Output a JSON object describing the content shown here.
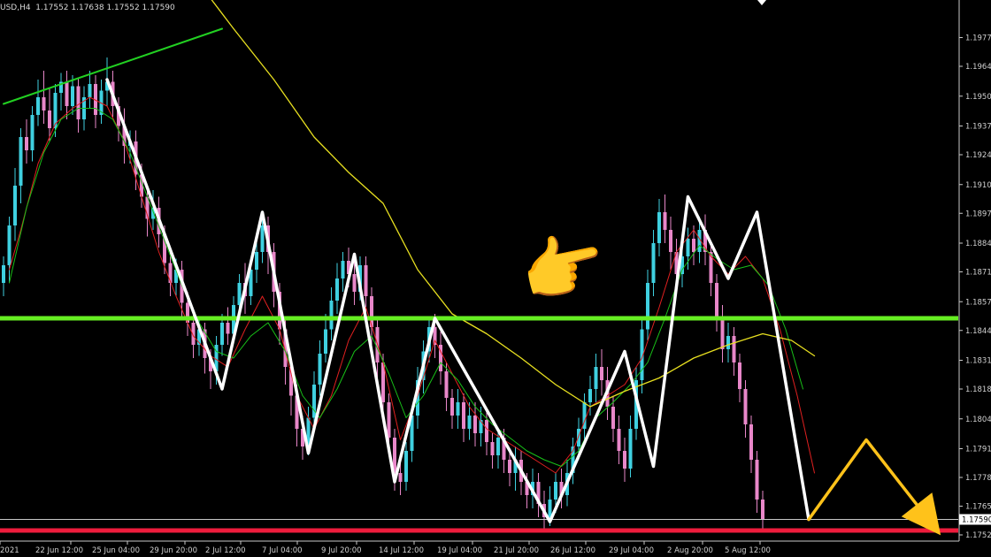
{
  "header": {
    "symbol_info": "USD,H4  1.17552 1.17638 1.17552 1.17590"
  },
  "colors": {
    "background": "#000000",
    "candle_bull": "#3fd0e0",
    "candle_bear": "#e887c9",
    "ma_fast": "#e02020",
    "ma_mid": "#18c018",
    "ma_slow": "#e8e020",
    "trendline": "#22d022",
    "support_line": "#66ee22",
    "low_line": "#ee1c3c",
    "zigzag": "#ffffff",
    "projection": "#ffc21a",
    "price_line": "#c8c8c8"
  },
  "annotation": {
    "pointer_icon": "pointing-hand-icon"
  },
  "chart_data": {
    "type": "candlestick",
    "title": "",
    "ylim": [
      1.175,
      1.199
    ],
    "y_ticks": [
      "1.19770",
      "1.19640",
      "1.19505",
      "1.19370",
      "1.19240",
      "1.19105",
      "1.18975",
      "1.18840",
      "1.18710",
      "1.18575",
      "1.18445",
      "1.18310",
      "1.18180",
      "1.18045",
      "1.17910",
      "1.17780",
      "1.17650",
      "1.17520"
    ],
    "x_ticks": [
      "2021",
      "22 Jun 12:00",
      "25 Jun 04:00",
      "29 Jun 20:00",
      "2 Jul 12:00",
      "7 Jul 04:00",
      "9 Jul 20:00",
      "14 Jul 12:00",
      "19 Jul 04:00",
      "21 Jul 20:00",
      "26 Jul 12:00",
      "29 Jul 04:00",
      "2 Aug 20:00",
      "5 Aug 12:00"
    ],
    "current_price": "1.17590",
    "support_level": 1.185,
    "low_level": 1.1754,
    "trendline": {
      "points": [
        [
          0,
          1.1947
        ],
        [
          38,
          1.1981
        ]
      ]
    },
    "zigzag": [
      [
        18,
        1.1958
      ],
      [
        38,
        1.1818
      ],
      [
        45,
        1.1898
      ],
      [
        53,
        1.1789
      ],
      [
        61,
        1.1879
      ],
      [
        68,
        1.1776
      ],
      [
        75,
        1.185
      ],
      [
        95,
        1.1758
      ],
      [
        108,
        1.1835
      ],
      [
        113,
        1.1783
      ],
      [
        119,
        1.1905
      ],
      [
        126,
        1.1868
      ],
      [
        131,
        1.1898
      ],
      [
        140,
        1.1759
      ]
    ],
    "projection": [
      [
        140,
        1.1759
      ],
      [
        150,
        1.1795
      ],
      [
        162,
        1.1755
      ]
    ],
    "ma_slow": [
      [
        33,
        1.2005
      ],
      [
        40,
        1.1981
      ],
      [
        47,
        1.1958
      ],
      [
        54,
        1.1932
      ],
      [
        60,
        1.1916
      ],
      [
        66,
        1.1902
      ],
      [
        72,
        1.1872
      ],
      [
        78,
        1.1852
      ],
      [
        84,
        1.1843
      ],
      [
        90,
        1.1832
      ],
      [
        96,
        1.182
      ],
      [
        102,
        1.181
      ],
      [
        108,
        1.1817
      ],
      [
        114,
        1.1823
      ],
      [
        120,
        1.1832
      ],
      [
        126,
        1.1838
      ],
      [
        132,
        1.1843
      ],
      [
        137,
        1.184
      ],
      [
        141,
        1.1833
      ]
    ],
    "ma_fast": [
      [
        1,
        1.1872
      ],
      [
        3,
        1.189
      ],
      [
        6,
        1.192
      ],
      [
        9,
        1.1938
      ],
      [
        12,
        1.1945
      ],
      [
        15,
        1.195
      ],
      [
        18,
        1.1946
      ],
      [
        21,
        1.193
      ],
      [
        24,
        1.1905
      ],
      [
        27,
        1.188
      ],
      [
        30,
        1.186
      ],
      [
        33,
        1.1842
      ],
      [
        36,
        1.1833
      ],
      [
        39,
        1.1828
      ],
      [
        42,
        1.1845
      ],
      [
        45,
        1.186
      ],
      [
        48,
        1.1845
      ],
      [
        51,
        1.1815
      ],
      [
        54,
        1.18
      ],
      [
        57,
        1.1815
      ],
      [
        60,
        1.184
      ],
      [
        63,
        1.1855
      ],
      [
        66,
        1.183
      ],
      [
        69,
        1.1795
      ],
      [
        72,
        1.1815
      ],
      [
        75,
        1.184
      ],
      [
        78,
        1.1825
      ],
      [
        81,
        1.181
      ],
      [
        84,
        1.18
      ],
      [
        87,
        1.1795
      ],
      [
        90,
        1.179
      ],
      [
        93,
        1.1785
      ],
      [
        96,
        1.178
      ],
      [
        99,
        1.179
      ],
      [
        102,
        1.181
      ],
      [
        105,
        1.1815
      ],
      [
        108,
        1.182
      ],
      [
        111,
        1.1832
      ],
      [
        114,
        1.1855
      ],
      [
        117,
        1.188
      ],
      [
        120,
        1.189
      ],
      [
        123,
        1.1878
      ],
      [
        126,
        1.187
      ],
      [
        129,
        1.1878
      ],
      [
        132,
        1.1868
      ],
      [
        135,
        1.1845
      ],
      [
        138,
        1.1815
      ],
      [
        141,
        1.178
      ]
    ],
    "ma_mid": [
      [
        1,
        1.1866
      ],
      [
        4,
        1.19
      ],
      [
        7,
        1.1925
      ],
      [
        10,
        1.194
      ],
      [
        13,
        1.1945
      ],
      [
        16,
        1.1945
      ],
      [
        19,
        1.194
      ],
      [
        22,
        1.1925
      ],
      [
        25,
        1.1905
      ],
      [
        28,
        1.1885
      ],
      [
        31,
        1.1865
      ],
      [
        34,
        1.1848
      ],
      [
        37,
        1.1835
      ],
      [
        40,
        1.1832
      ],
      [
        43,
        1.1842
      ],
      [
        46,
        1.1848
      ],
      [
        49,
        1.1835
      ],
      [
        52,
        1.1815
      ],
      [
        55,
        1.1805
      ],
      [
        58,
        1.1818
      ],
      [
        61,
        1.1835
      ],
      [
        64,
        1.1842
      ],
      [
        67,
        1.1825
      ],
      [
        70,
        1.1805
      ],
      [
        73,
        1.1815
      ],
      [
        76,
        1.183
      ],
      [
        79,
        1.1822
      ],
      [
        82,
        1.181
      ],
      [
        85,
        1.1802
      ],
      [
        88,
        1.1796
      ],
      [
        91,
        1.179
      ],
      [
        94,
        1.1786
      ],
      [
        97,
        1.1783
      ],
      [
        100,
        1.179
      ],
      [
        103,
        1.1805
      ],
      [
        106,
        1.1812
      ],
      [
        109,
        1.182
      ],
      [
        112,
        1.183
      ],
      [
        115,
        1.185
      ],
      [
        118,
        1.1872
      ],
      [
        121,
        1.1883
      ],
      [
        124,
        1.1877
      ],
      [
        127,
        1.1872
      ],
      [
        130,
        1.1874
      ],
      [
        133,
        1.1865
      ],
      [
        136,
        1.1845
      ],
      [
        139,
        1.1818
      ]
    ],
    "candles": [
      [
        1.1866,
        1.1874,
        1.186,
        1.1878
      ],
      [
        1.1874,
        1.1892,
        1.1866,
        1.1896
      ],
      [
        1.1892,
        1.191,
        1.1885,
        1.1918
      ],
      [
        1.191,
        1.1932,
        1.1902,
        1.1936
      ],
      [
        1.1932,
        1.1926,
        1.192,
        1.194
      ],
      [
        1.1926,
        1.1942,
        1.1921,
        1.1946
      ],
      [
        1.1942,
        1.195,
        1.1937,
        1.1958
      ],
      [
        1.195,
        1.1944,
        1.1938,
        1.1962
      ],
      [
        1.1944,
        1.1936,
        1.193,
        1.1954
      ],
      [
        1.1936,
        1.1952,
        1.1932,
        1.1956
      ],
      [
        1.1952,
        1.1957,
        1.1944,
        1.1961
      ],
      [
        1.1957,
        1.1946,
        1.194,
        1.1962
      ],
      [
        1.1946,
        1.1955,
        1.1942,
        1.196
      ],
      [
        1.1955,
        1.194,
        1.1934,
        1.1959
      ],
      [
        1.194,
        1.195,
        1.1935,
        1.1955
      ],
      [
        1.195,
        1.1956,
        1.1945,
        1.1962
      ],
      [
        1.1956,
        1.1942,
        1.1936,
        1.196
      ],
      [
        1.1942,
        1.1953,
        1.1938,
        1.1958
      ],
      [
        1.1953,
        1.1957,
        1.1946,
        1.1968
      ],
      [
        1.1957,
        1.1946,
        1.1941,
        1.1962
      ],
      [
        1.1946,
        1.1937,
        1.193,
        1.195
      ],
      [
        1.1937,
        1.1928,
        1.192,
        1.1945
      ],
      [
        1.1928,
        1.193,
        1.192,
        1.1935
      ],
      [
        1.193,
        1.1915,
        1.1908,
        1.1935
      ],
      [
        1.1915,
        1.1905,
        1.19,
        1.192
      ],
      [
        1.1905,
        1.1895,
        1.1887,
        1.191
      ],
      [
        1.1895,
        1.19,
        1.189,
        1.1908
      ],
      [
        1.19,
        1.1888,
        1.1882,
        1.1905
      ],
      [
        1.1888,
        1.1875,
        1.187,
        1.1892
      ],
      [
        1.1875,
        1.1866,
        1.186,
        1.188
      ],
      [
        1.1866,
        1.1872,
        1.186,
        1.1877
      ],
      [
        1.1872,
        1.1857,
        1.185,
        1.1876
      ],
      [
        1.1857,
        1.1848,
        1.1842,
        1.1862
      ],
      [
        1.1848,
        1.1838,
        1.1832,
        1.1852
      ],
      [
        1.1838,
        1.1845,
        1.1833,
        1.185
      ],
      [
        1.1845,
        1.1832,
        1.1825,
        1.1848
      ],
      [
        1.1832,
        1.1826,
        1.1818,
        1.1836
      ],
      [
        1.1826,
        1.1838,
        1.182,
        1.1842
      ],
      [
        1.1838,
        1.1848,
        1.1833,
        1.1852
      ],
      [
        1.1848,
        1.1843,
        1.1838,
        1.1855
      ],
      [
        1.1843,
        1.1856,
        1.184,
        1.186
      ],
      [
        1.1856,
        1.1866,
        1.185,
        1.187
      ],
      [
        1.1866,
        1.186,
        1.1852,
        1.1875
      ],
      [
        1.186,
        1.1872,
        1.1856,
        1.1877
      ],
      [
        1.1872,
        1.188,
        1.1866,
        1.1888
      ],
      [
        1.188,
        1.1892,
        1.1875,
        1.1897
      ],
      [
        1.1892,
        1.188,
        1.187,
        1.1896
      ],
      [
        1.188,
        1.1862,
        1.1855,
        1.1884
      ],
      [
        1.1862,
        1.1845,
        1.1838,
        1.1866
      ],
      [
        1.1845,
        1.1828,
        1.182,
        1.185
      ],
      [
        1.1828,
        1.1815,
        1.1806,
        1.1832
      ],
      [
        1.1815,
        1.18,
        1.1792,
        1.182
      ],
      [
        1.18,
        1.1792,
        1.1786,
        1.1806
      ],
      [
        1.1792,
        1.1805,
        1.1788,
        1.181
      ],
      [
        1.1805,
        1.182,
        1.18,
        1.1826
      ],
      [
        1.182,
        1.1834,
        1.1815,
        1.184
      ],
      [
        1.1834,
        1.1845,
        1.183,
        1.1852
      ],
      [
        1.1845,
        1.1858,
        1.184,
        1.1864
      ],
      [
        1.1858,
        1.1868,
        1.1852,
        1.1875
      ],
      [
        1.1868,
        1.1876,
        1.1862,
        1.188
      ],
      [
        1.1876,
        1.187,
        1.1864,
        1.1882
      ],
      [
        1.187,
        1.1862,
        1.1856,
        1.1876
      ],
      [
        1.1862,
        1.1874,
        1.1858,
        1.1878
      ],
      [
        1.1874,
        1.186,
        1.1852,
        1.1878
      ],
      [
        1.186,
        1.1846,
        1.1838,
        1.1864
      ],
      [
        1.1846,
        1.183,
        1.1822,
        1.185
      ],
      [
        1.183,
        1.1812,
        1.1805,
        1.1834
      ],
      [
        1.1812,
        1.1796,
        1.1788,
        1.1816
      ],
      [
        1.1796,
        1.178,
        1.1772,
        1.18
      ],
      [
        1.178,
        1.1776,
        1.177,
        1.1786
      ],
      [
        1.1776,
        1.179,
        1.1772,
        1.1794
      ],
      [
        1.179,
        1.1806,
        1.1785,
        1.181
      ],
      [
        1.1806,
        1.1822,
        1.18,
        1.1828
      ],
      [
        1.1822,
        1.1835,
        1.1816,
        1.184
      ],
      [
        1.1835,
        1.1846,
        1.183,
        1.1851
      ],
      [
        1.1846,
        1.1838,
        1.1832,
        1.1852
      ],
      [
        1.1838,
        1.1826,
        1.182,
        1.1844
      ],
      [
        1.1826,
        1.1814,
        1.1808,
        1.183
      ],
      [
        1.1814,
        1.1806,
        1.18,
        1.1818
      ],
      [
        1.1806,
        1.1812,
        1.18,
        1.1818
      ],
      [
        1.1812,
        1.18,
        1.1794,
        1.1816
      ],
      [
        1.18,
        1.1806,
        1.1795,
        1.1812
      ],
      [
        1.1806,
        1.1798,
        1.1792,
        1.1812
      ],
      [
        1.1798,
        1.1804,
        1.1792,
        1.181
      ],
      [
        1.1804,
        1.1794,
        1.1788,
        1.1808
      ],
      [
        1.1794,
        1.1788,
        1.1782,
        1.1798
      ],
      [
        1.1788,
        1.1796,
        1.1782,
        1.18
      ],
      [
        1.1796,
        1.1786,
        1.178,
        1.18
      ],
      [
        1.1786,
        1.178,
        1.1774,
        1.179
      ],
      [
        1.178,
        1.1786,
        1.1772,
        1.1792
      ],
      [
        1.1786,
        1.1776,
        1.177,
        1.179
      ],
      [
        1.1776,
        1.177,
        1.1764,
        1.178
      ],
      [
        1.177,
        1.1776,
        1.1764,
        1.1782
      ],
      [
        1.1776,
        1.1766,
        1.176,
        1.178
      ],
      [
        1.1766,
        1.176,
        1.1755,
        1.1772
      ],
      [
        1.176,
        1.1768,
        1.1756,
        1.1774
      ],
      [
        1.1768,
        1.1776,
        1.1762,
        1.178
      ],
      [
        1.1776,
        1.177,
        1.1764,
        1.1782
      ],
      [
        1.177,
        1.178,
        1.1765,
        1.1786
      ],
      [
        1.178,
        1.1792,
        1.1775,
        1.1796
      ],
      [
        1.1792,
        1.18,
        1.1786,
        1.1805
      ],
      [
        1.18,
        1.1812,
        1.1795,
        1.1816
      ],
      [
        1.1812,
        1.1818,
        1.1806,
        1.1824
      ],
      [
        1.1818,
        1.1828,
        1.1812,
        1.1834
      ],
      [
        1.1828,
        1.1822,
        1.1815,
        1.1836
      ],
      [
        1.1822,
        1.181,
        1.1804,
        1.1828
      ],
      [
        1.181,
        1.18,
        1.1794,
        1.1815
      ],
      [
        1.18,
        1.179,
        1.1784,
        1.1806
      ],
      [
        1.179,
        1.1782,
        1.1776,
        1.1796
      ],
      [
        1.1782,
        1.18,
        1.1778,
        1.1806
      ],
      [
        1.18,
        1.1822,
        1.1795,
        1.1828
      ],
      [
        1.1822,
        1.1845,
        1.1816,
        1.185
      ],
      [
        1.1845,
        1.1866,
        1.184,
        1.1872
      ],
      [
        1.1866,
        1.1884,
        1.186,
        1.189
      ],
      [
        1.1884,
        1.1898,
        1.1878,
        1.1904
      ],
      [
        1.1898,
        1.189,
        1.1884,
        1.1906
      ],
      [
        1.189,
        1.188,
        1.1872,
        1.1896
      ],
      [
        1.188,
        1.187,
        1.1864,
        1.1886
      ],
      [
        1.187,
        1.1878,
        1.1864,
        1.1882
      ],
      [
        1.1878,
        1.1886,
        1.1872,
        1.1891
      ],
      [
        1.1886,
        1.188,
        1.1874,
        1.1892
      ],
      [
        1.188,
        1.189,
        1.1875,
        1.1896
      ],
      [
        1.189,
        1.188,
        1.1874,
        1.1897
      ],
      [
        1.188,
        1.1866,
        1.186,
        1.1884
      ],
      [
        1.1866,
        1.185,
        1.1844,
        1.187
      ],
      [
        1.185,
        1.1836,
        1.183,
        1.1856
      ],
      [
        1.1836,
        1.1842,
        1.183,
        1.1848
      ],
      [
        1.1842,
        1.183,
        1.1824,
        1.1846
      ],
      [
        1.183,
        1.1818,
        1.1812,
        1.1834
      ],
      [
        1.1818,
        1.1802,
        1.1796,
        1.1822
      ],
      [
        1.1802,
        1.1786,
        1.178,
        1.1806
      ],
      [
        1.1786,
        1.1768,
        1.1762,
        1.179
      ],
      [
        1.1768,
        1.1759,
        1.1755,
        1.1772
      ]
    ]
  }
}
